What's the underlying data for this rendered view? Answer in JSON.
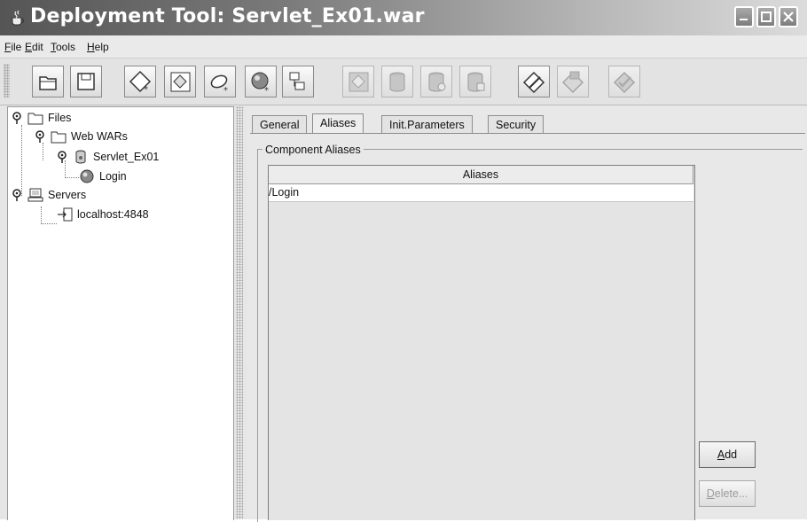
{
  "window": {
    "title": "Deployment Tool: Servlet_Ex01.war"
  },
  "menu": [
    {
      "label": "File",
      "mnemonic": "F"
    },
    {
      "label": "Edit",
      "mnemonic": "E"
    },
    {
      "label": "Tools",
      "mnemonic": "T"
    },
    {
      "label": "Help",
      "mnemonic": "H"
    }
  ],
  "toolbar": {
    "icons": [
      "open-file-icon",
      "save-icon",
      "new-application-icon",
      "new-web-component-icon",
      "new-ejb-icon",
      "new-web-service-icon",
      "new-connector-icon",
      "deploy-module-icon",
      "database-icon",
      "database-add-icon",
      "database-config-icon",
      "edit-icon",
      "verify-icon",
      "checkmark-icon"
    ]
  },
  "tree": {
    "files": "Files",
    "web_wars": "Web WARs",
    "servlet": "Servlet_Ex01",
    "login": "Login",
    "servers": "Servers",
    "localhost": "localhost:4848"
  },
  "tabs": [
    "General",
    "Aliases",
    "Init.Parameters",
    "Security"
  ],
  "active_tab": "Aliases",
  "aliases_panel": {
    "group_label": "Component Aliases",
    "column_header": "Aliases",
    "rows": [
      "/Login"
    ],
    "add_label": "Add",
    "add_mnemonic": "A",
    "delete_label": "Delete...",
    "delete_mnemonic": "D"
  }
}
